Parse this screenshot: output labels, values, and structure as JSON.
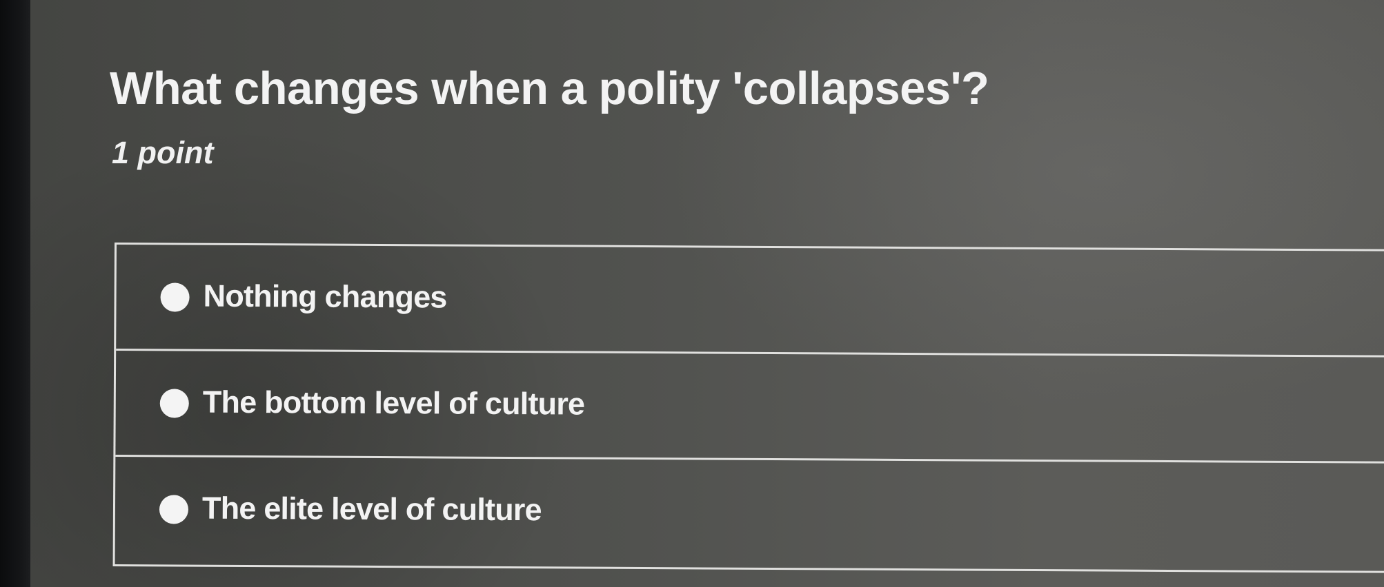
{
  "question": {
    "title": "What changes when a polity 'collapses'?",
    "points": "1 point"
  },
  "options": [
    {
      "label": "Nothing changes",
      "selected": false
    },
    {
      "label": "The bottom level of culture",
      "selected": false
    },
    {
      "label": "The elite level of culture",
      "selected": false
    }
  ],
  "colors": {
    "background": "#51524f",
    "text": "#f3f3f3",
    "border": "#e0e0de"
  }
}
